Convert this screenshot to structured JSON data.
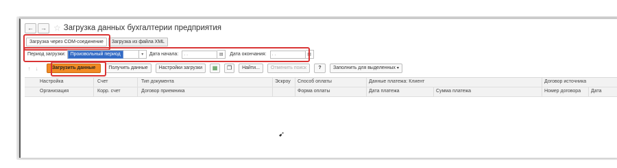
{
  "window": {
    "title": "Загрузка данных бухгалтерии предприятия",
    "back_icon": "←",
    "forward_icon": "→",
    "star_icon": "☆"
  },
  "tabs": [
    {
      "label": "Загрузка через COM-соединение",
      "active": true
    },
    {
      "label": "Загрузка из файла XML",
      "active": false
    }
  ],
  "period": {
    "period_label": "Период загрузки:",
    "period_value": "Произвольный период",
    "start_label": "Дата начала:",
    "start_value": ". .",
    "end_label": "Дата окончания:",
    "end_value": ". ."
  },
  "toolbar": {
    "load": "Загрузить данные",
    "get": "Получить данные",
    "settings": "Настройки загрузки",
    "find": "Найти...",
    "cancel_search": "Отменить поиск",
    "help": "?",
    "fill_selected": "Заполнить для выделенных"
  },
  "table": {
    "row1": [
      "Настройка",
      "Счет",
      "Тип документа",
      "Эскроу",
      "Способ оплаты",
      "Данные платежа: Клиент",
      "Договор источника"
    ],
    "row2": [
      "Организация",
      "Корр. счет",
      "Договор приемника",
      "Форма оплаты",
      "Дата платежа",
      "Сумма платежа",
      "Номер договора",
      "Дата"
    ]
  },
  "colors": {
    "accent": "#f08a24",
    "highlight": "#d93333",
    "selection": "#316ac5",
    "check": "#3aa53a"
  }
}
